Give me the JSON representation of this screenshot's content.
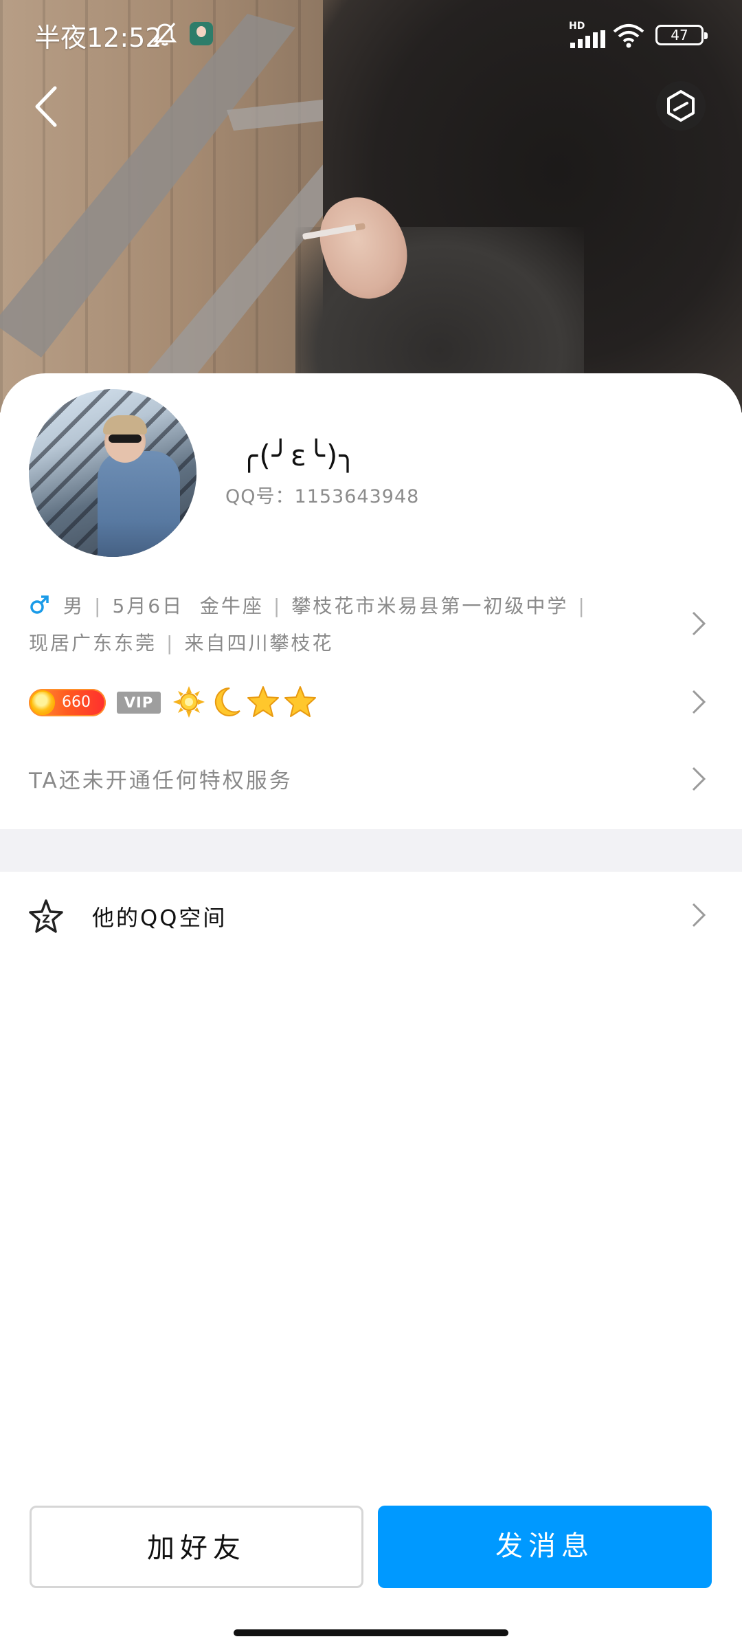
{
  "status_bar": {
    "time": "半夜12:52",
    "network_label": "HD",
    "battery": "47"
  },
  "profile": {
    "nickname": "╭(╯ε╰)╮",
    "qq_label": "QQ号：",
    "qq_number": "1153643948",
    "gender": "男",
    "birthday": "5月6日",
    "zodiac": "金牛座",
    "school": "攀枝花市米易县第一初级中学",
    "residence": "现居广东东莞",
    "hometown": "来自四川攀枝花"
  },
  "vip": {
    "level_score": "660",
    "vip_label": "VIP",
    "level_icons": [
      "sun-icon",
      "moon-icon",
      "star-icon",
      "star-icon"
    ]
  },
  "privilege": {
    "text": "TA还未开通任何特权服务"
  },
  "qzone": {
    "label": "他的QQ空间"
  },
  "actions": {
    "add_friend": "加好友",
    "send_message": "发消息"
  },
  "colors": {
    "primary": "#0099ff",
    "male": "#1a9be8",
    "divider": "#f2f2f5"
  }
}
